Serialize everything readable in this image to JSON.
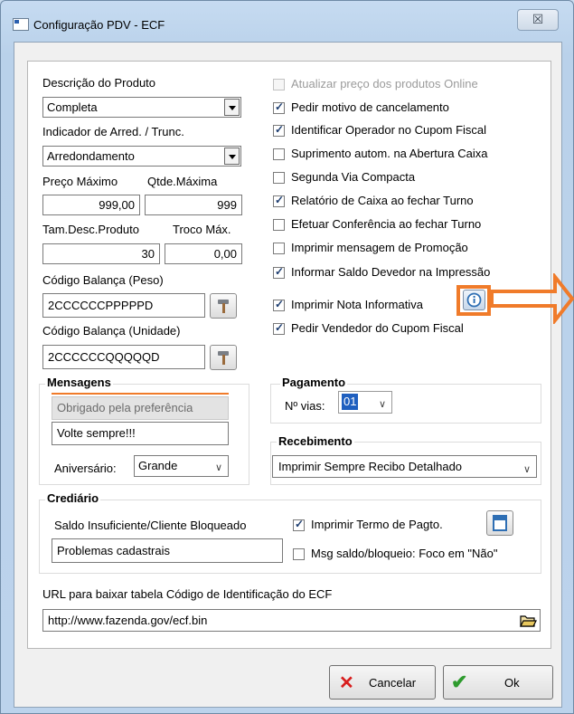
{
  "window": {
    "title": "Configuração PDV - ECF",
    "close_glyph": "☒"
  },
  "left": {
    "descricao_label": "Descrição do Produto",
    "descricao_value": "Completa",
    "arred_label": "Indicador de Arred. / Trunc.",
    "arred_value": "Arredondamento",
    "preco_label": "Preço Máximo",
    "preco_value": "999,00",
    "qtde_label": "Qtde.Máxima",
    "qtde_value": "999",
    "tamdesc_label": "Tam.Desc.Produto",
    "tamdesc_value": "30",
    "troco_label": "Troco Máx.",
    "troco_value": "0,00",
    "cod_peso_label": "Código Balança (Peso)",
    "cod_peso_value": "2CCCCCCPPPPPD",
    "cod_unid_label": "Código Balança (Unidade)",
    "cod_unid_value": "2CCCCCCQQQQQD"
  },
  "checks": [
    {
      "label": "Atualizar preço dos produtos Online",
      "checked": false,
      "disabled": true
    },
    {
      "label": "Pedir motivo de cancelamento",
      "checked": true,
      "disabled": false
    },
    {
      "label": "Identificar Operador no Cupom Fiscal",
      "checked": true,
      "disabled": false
    },
    {
      "label": "Suprimento autom. na Abertura Caixa",
      "checked": false,
      "disabled": false
    },
    {
      "label": "Segunda Via Compacta",
      "checked": false,
      "disabled": false
    },
    {
      "label": "Relatório de Caixa ao fechar Turno",
      "checked": true,
      "disabled": false
    },
    {
      "label": "Efetuar Conferência ao fechar Turno",
      "checked": false,
      "disabled": false
    },
    {
      "label": "Imprimir mensagem de Promoção",
      "checked": false,
      "disabled": false
    },
    {
      "label": "Informar Saldo Devedor na Impressão",
      "checked": true,
      "disabled": false
    },
    {
      "label": "Imprimir Nota Informativa",
      "checked": true,
      "disabled": false
    },
    {
      "label": "Pedir Vendedor do Cupom Fiscal",
      "checked": true,
      "disabled": false
    }
  ],
  "mensagens": {
    "title": "Mensagens",
    "msg1": "Obrigado pela preferência",
    "msg2": "Volte sempre!!!",
    "aniversario_label": "Aniversário:",
    "aniversario_value": "Grande"
  },
  "pagamento": {
    "title": "Pagamento",
    "vias_label": "Nº vias:",
    "vias_value": "01"
  },
  "recebimento": {
    "title": "Recebimento",
    "value": "Imprimir Sempre Recibo Detalhado"
  },
  "crediario": {
    "title": "Crediário",
    "saldo_label": "Saldo Insuficiente/Cliente Bloqueado",
    "saldo_value": "Problemas cadastrais",
    "termo_label": "Imprimir Termo de Pagto.",
    "termo_checked": true,
    "msg_saldo_label": "Msg saldo/bloqueio: Foco em \"Não\"",
    "msg_saldo_checked": false
  },
  "url": {
    "label": "URL para baixar tabela Código de Identificação do ECF",
    "value": "http://www.fazenda.gov/ecf.bin"
  },
  "buttons": {
    "cancel": "Cancelar",
    "ok": "Ok"
  },
  "colors": {
    "annotation": "#f07b2a",
    "info_blue": "#2f6fb4",
    "cancel_x": "#d81e1e",
    "ok_check": "#2e9b2e"
  }
}
